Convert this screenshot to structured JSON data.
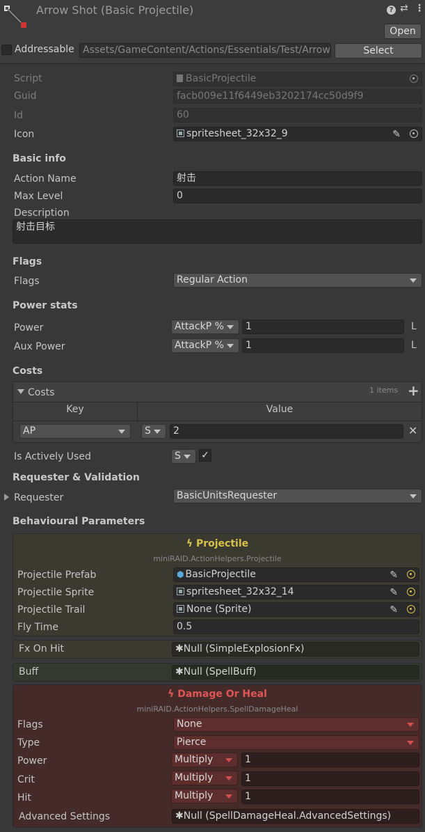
{
  "header": {
    "title": "Arrow Shot (Basic Projectile)",
    "open_label": "Open",
    "addressable_label": "Addressable",
    "address_path": "Assets/GameContent/Actions/Essentials/Test/Arrow",
    "select_label": "Select"
  },
  "fields": {
    "script_label": "Script",
    "script_value": "BasicProjectile",
    "guid_label": "Guid",
    "guid_value": "facb009e11f6449eb3202174cc50d9f9",
    "id_label": "Id",
    "id_value": "60",
    "icon_label": "Icon",
    "icon_value": "spritesheet_32x32_9"
  },
  "basic_info": {
    "header": "Basic info",
    "action_name_label": "Action Name",
    "action_name_value": "射击",
    "max_level_label": "Max Level",
    "max_level_value": "0",
    "description_label": "Description",
    "description_value": "射击目标"
  },
  "flags": {
    "header": "Flags",
    "label": "Flags",
    "value": "Regular Action"
  },
  "power_stats": {
    "header": "Power stats",
    "power_label": "Power",
    "power_mode": "AttackP %",
    "power_value": "1",
    "power_suffix": "L",
    "aux_label": "Aux Power",
    "aux_mode": "AttackP %",
    "aux_value": "1",
    "aux_suffix": "L"
  },
  "costs": {
    "header": "Costs",
    "list_label": "Costs",
    "count": "1 items",
    "key_header": "Key",
    "value_header": "Value",
    "row_key": "AP",
    "row_mode": "S",
    "row_value": "2",
    "actively_used_label": "Is Actively Used",
    "actively_used_mode": "S",
    "actively_used_checked": true
  },
  "requester": {
    "header": "Requester & Validation",
    "label": "Requester",
    "value": "BasicUnitsRequester"
  },
  "behaviour": {
    "header": "Behavioural Parameters",
    "projectile": {
      "title": "Projectile",
      "subtitle": "miniRAID.ActionHelpers.Projectile",
      "prefab_label": "Projectile Prefab",
      "prefab_value": "BasicProjectile",
      "sprite_label": "Projectile Sprite",
      "sprite_value": "spritesheet_32x32_14",
      "trail_label": "Projectile Trail",
      "trail_value": "None (Sprite)",
      "fly_label": "Fly Time",
      "fly_value": "0.5"
    },
    "fx_label": "Fx On Hit",
    "fx_value": "Null (SimpleExplosionFx)",
    "buff_label": "Buff",
    "buff_value": "Null (SpellBuff)",
    "damage": {
      "title": "Damage Or Heal",
      "subtitle": "miniRAID.ActionHelpers.SpellDamageHeal",
      "flags_label": "Flags",
      "flags_value": "None",
      "type_label": "Type",
      "type_value": "Pierce",
      "power_label": "Power",
      "power_mode": "Multiply",
      "power_value": "1",
      "crit_label": "Crit",
      "crit_mode": "Multiply",
      "crit_value": "1",
      "hit_label": "Hit",
      "hit_mode": "Multiply",
      "hit_value": "1",
      "adv_label": "Advanced Settings",
      "adv_value": "Null (SpellDamageHeal.AdvancedSettings)"
    }
  },
  "colors": {
    "projectile_title": "#d9c24a",
    "damage_title": "#e05555",
    "damage_bg": "#452a2a",
    "projectile_bg": "#3a3a31"
  }
}
